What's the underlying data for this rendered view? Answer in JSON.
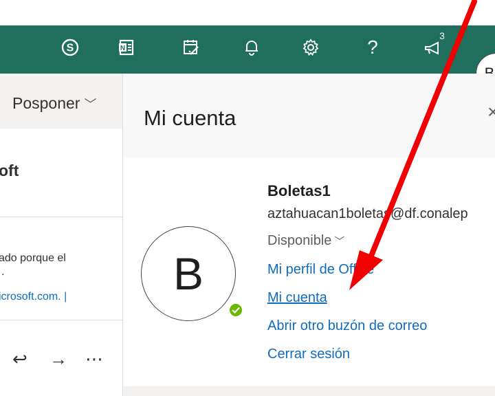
{
  "topbar": {
    "accent": "#1f6f5c",
    "icons": [
      "skype-icon",
      "onenote-icon",
      "my-day-icon",
      "bell-icon",
      "gear-icon",
      "help-icon",
      "megaphone-icon"
    ],
    "help_glyph": "?",
    "notification_count": "3",
    "avatar_initial": "B"
  },
  "left_pane": {
    "posponer_label": "Posponer",
    "sender_fragment": "oft",
    "body_line_1": "ado porque el",
    "body_line_2": ".",
    "body_line_3": "icrosoft.com. |"
  },
  "account_panel": {
    "title": "Mi cuenta",
    "close_glyph": "×",
    "avatar_initial": "B",
    "user_name": "Boletas1",
    "user_email": "aztahuacan1boletas@df.conalep",
    "status_label": "Disponible",
    "status_color": "#6bb700",
    "links": {
      "office_profile": "Mi perfil de Office",
      "my_account": "Mi cuenta",
      "open_other_mailbox": "Abrir otro buzón de correo",
      "sign_out": "Cerrar sesión"
    },
    "link_color": "#0f6cbd"
  },
  "annotation": {
    "arrow_color": "#f00000"
  }
}
